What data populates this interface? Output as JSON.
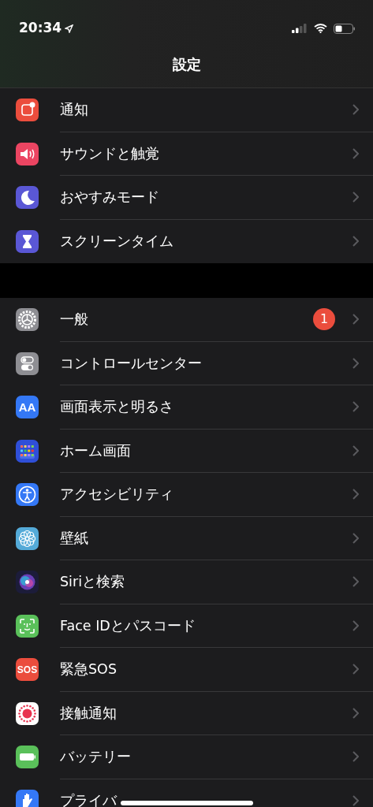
{
  "status_bar": {
    "time": "20:34"
  },
  "title": "設定",
  "groups": [
    {
      "items": [
        {
          "label": "通知",
          "kind": "notifications",
          "color": "#eb4d3d"
        },
        {
          "label": "サウンドと触覚",
          "kind": "sound",
          "color": "#eb4562"
        },
        {
          "label": "おやすみモード",
          "kind": "moon",
          "color": "#5a57d5"
        },
        {
          "label": "スクリーンタイム",
          "kind": "hourglass",
          "color": "#5a57d5"
        }
      ]
    },
    {
      "items": [
        {
          "label": "一般",
          "kind": "gear",
          "color": "#8e8e93",
          "badge": "1"
        },
        {
          "label": "コントロールセンター",
          "kind": "toggles",
          "color": "#8e8e93"
        },
        {
          "label": "画面表示と明るさ",
          "kind": "text",
          "icon_text": "AA",
          "color": "#3478f6"
        },
        {
          "label": "ホーム画面",
          "kind": "grid",
          "color": "#2f4fd8"
        },
        {
          "label": "アクセシビリティ",
          "kind": "person",
          "color": "#3478f6"
        },
        {
          "label": "壁紙",
          "kind": "flower",
          "color": "#54aad8"
        },
        {
          "label": "Siriと検索",
          "kind": "orb",
          "color": "#1c1c3a"
        },
        {
          "label": "Face IDとパスコード",
          "kind": "face",
          "color": "#5ac05a"
        },
        {
          "label": "緊急SOS",
          "kind": "text",
          "icon_text": "SOS",
          "color": "#eb4d3d"
        },
        {
          "label": "接触通知",
          "kind": "dots",
          "color": "#ffffff"
        },
        {
          "label": "バッテリー",
          "kind": "battery",
          "color": "#5ac05a"
        },
        {
          "label": "プライバ",
          "kind": "hand",
          "color": "#3478f6"
        }
      ]
    }
  ]
}
